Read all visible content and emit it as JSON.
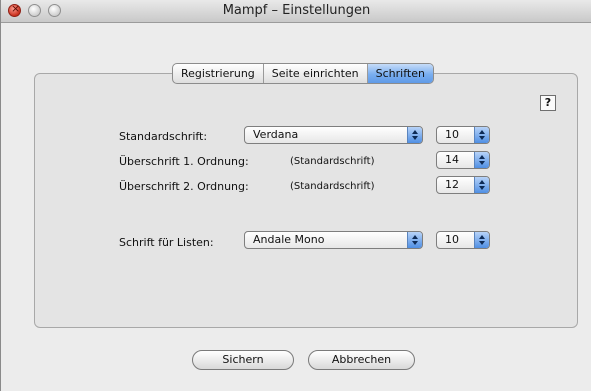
{
  "window": {
    "title": "Mampf – Einstellungen"
  },
  "tabs": [
    "Registrierung",
    "Seite einrichten",
    "Schriften"
  ],
  "active_tab": "Schriften",
  "help": {
    "label": "?"
  },
  "rows": {
    "standard": {
      "label": "Standardschrift:",
      "font": "Verdana",
      "size": "10"
    },
    "heading1": {
      "label": "Überschrift 1. Ordnung:",
      "font": "(Standardschrift)",
      "size": "14"
    },
    "heading2": {
      "label": "Überschrift 2. Ordnung:",
      "font": "(Standardschrift)",
      "size": "12"
    },
    "lists": {
      "label": "Schrift für Listen:",
      "font": "Andale Mono",
      "size": "10"
    }
  },
  "buttons": {
    "save": "Sichern",
    "cancel": "Abbrechen"
  }
}
